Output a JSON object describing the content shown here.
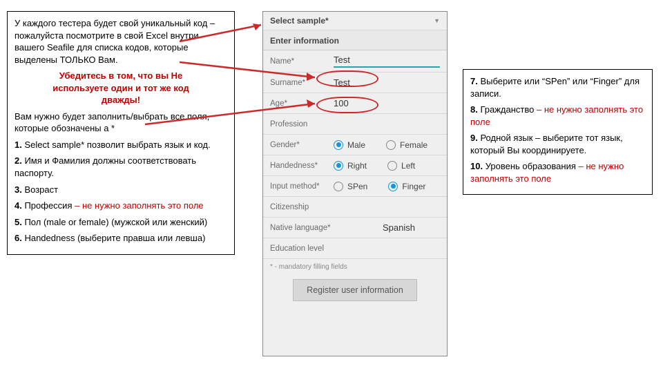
{
  "left": {
    "intro": "У каждого тестера будет свой уникальный код – пожалуйста посмотрите в свой Excel внутри вашего Seafile для списка кодов, которые выделены ТОЛЬКО Вам.",
    "warn_l1": "Убедитесь в том, что вы Не",
    "warn_l2": "используете один и тот же код",
    "warn_l3": "дважды!",
    "para2": "Вам нужно будет заполнить/выбрать все поля, которые обозначены a *",
    "i1b": "1.",
    "i1": " Select sample* позволит выбрать язык и код.",
    "i2b": "2.",
    "i2": " Имя и Фамилия должны соответствовать паспорту.",
    "i3b": "3.",
    "i3": " Возраст",
    "i4b": "4.",
    "i4a": " Профессия ",
    "i4r": "– не нужно заполнять это поле",
    "i5b": "5.",
    "i5": " Пол (male or female) (мужской или женский)",
    "i6b": "6.",
    "i6": " Handedness (выберите правша или левша)"
  },
  "right": {
    "i7b": "7.",
    "i7": " Выберите или “SPen” или “Finger” для записи.",
    "i8b": "8.",
    "i8a": " Гражданство ",
    "i8r": "– не нужно заполнять это поле",
    "i9b": "9.",
    "i9": " Родной язык – выберите тот язык, который Вы координируете.",
    "i10b": "10.",
    "i10a": " Уровень образования ",
    "i10r": "– не нужно заполнять это поле"
  },
  "phone": {
    "select_sample": "Select sample*",
    "enter_info": "Enter information",
    "name_label": "Name*",
    "name_value": "Test",
    "surname_label": "Surname*",
    "surname_value": "Test",
    "age_label": "Age*",
    "age_value": "100",
    "profession_label": "Profession",
    "gender_label": "Gender*",
    "gender_male": "Male",
    "gender_female": "Female",
    "hand_label": "Handedness*",
    "hand_right": "Right",
    "hand_left": "Left",
    "input_label": "Input method*",
    "input_spen": "SPen",
    "input_finger": "Finger",
    "citizen_label": "Citizenship",
    "lang_label": "Native language*",
    "lang_value": "Spanish",
    "edu_label": "Education level",
    "footnote": "* - mandatory filling fields",
    "register": "Register user information"
  }
}
